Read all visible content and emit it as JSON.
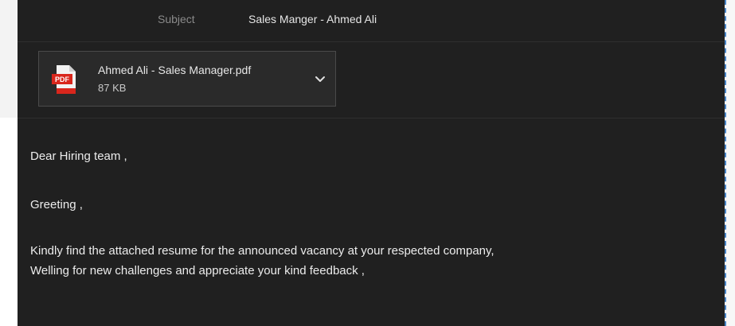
{
  "header": {
    "subject_label": "Subject",
    "subject_value": "Sales Manger - Ahmed Ali"
  },
  "attachment": {
    "file_name": "Ahmed Ali - Sales Manager.pdf",
    "file_size": "87 KB",
    "icon": "pdf-file-icon",
    "icon_text": "PDF",
    "menu_icon": "chevron-down-icon"
  },
  "body": {
    "greeting": "Dear Hiring team ,",
    "salutation": "Greeting ,",
    "line1": "Kindly find the attached resume for the announced vacancy at your respected company,",
    "line2": "Welling for new challenges and appreciate your kind feedback ,"
  },
  "colors": {
    "compose_background": "#202020",
    "attachment_background": "#2a2a2a",
    "pdf_red": "#d9261c",
    "text": "#ececec",
    "label": "#8a8a8a"
  }
}
